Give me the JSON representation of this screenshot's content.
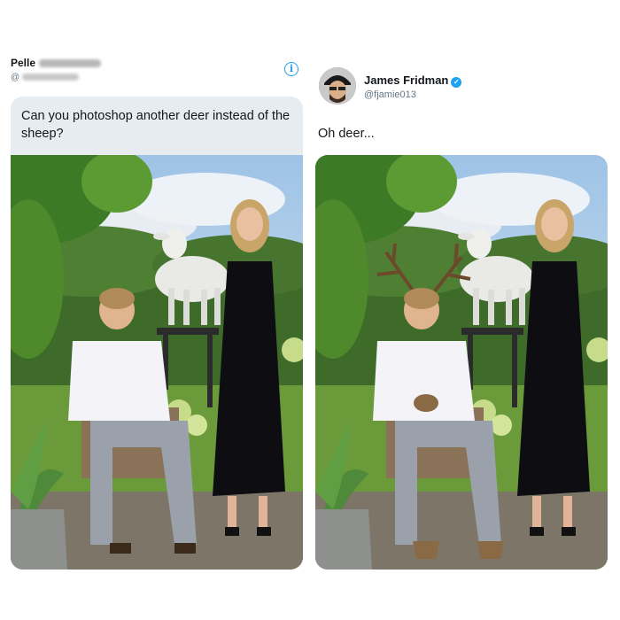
{
  "left_tweet": {
    "user_name": "Pelle",
    "handle_prefix": "@",
    "question": "Can you photoshop another deer instead of the sheep?"
  },
  "right_tweet": {
    "user_name": "James Fridman",
    "handle": "@fjamie013",
    "reply": "Oh deer..."
  },
  "colors": {
    "accent": "#1da1f2",
    "bubble": "#e6ecf0",
    "text": "#14171a",
    "muted": "#657786"
  },
  "icons": {
    "info": "info-icon",
    "verified": "verified-badge-icon"
  }
}
